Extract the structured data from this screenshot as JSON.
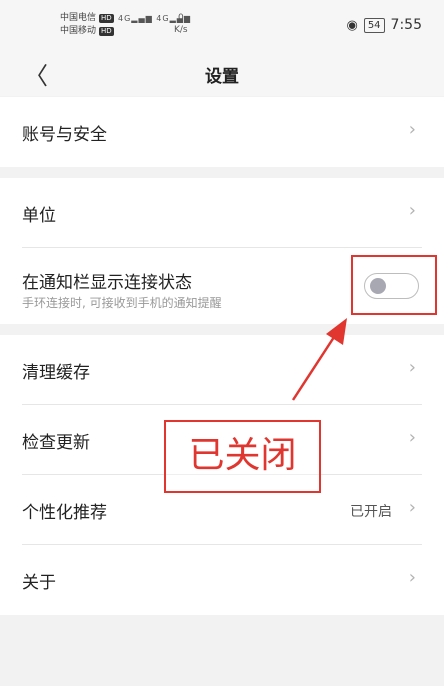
{
  "status_bar": {
    "carrier1": "中国电信",
    "carrier2": "中国移动",
    "hd": "HD",
    "net_label": "4G",
    "speed_value": "0",
    "speed_unit": "K/s",
    "battery": "54",
    "time": "7:55"
  },
  "header": {
    "title": "设置"
  },
  "settings": {
    "account": {
      "label": "账号与安全"
    },
    "unit": {
      "label": "单位"
    },
    "notify": {
      "label": "在通知栏显示连接状态",
      "sub": "手环连接时, 可接收到手机的通知提醒",
      "enabled": false
    },
    "cache": {
      "label": "清理缓存"
    },
    "update": {
      "label": "检查更新"
    },
    "personal": {
      "label": "个性化推荐",
      "value": "已开启"
    },
    "about": {
      "label": "关于"
    }
  },
  "annotation": {
    "text": "已关闭"
  },
  "colors": {
    "accent_red": "#e0362f",
    "background": "#f2f2f2"
  },
  "icons": [
    "back-chevron-icon",
    "chevron-right-icon",
    "eye-icon",
    "battery-icon",
    "signal-icon"
  ]
}
